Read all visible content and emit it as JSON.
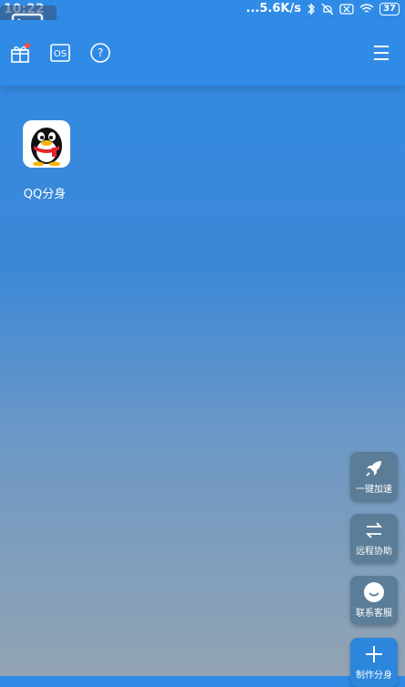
{
  "status_bar": {
    "time": "10:22",
    "network_speed": "...5.6K/s",
    "battery_level": "37"
  },
  "header": {
    "icons": [
      "gift-icon",
      "os-icon",
      "help-icon",
      "menu-icon"
    ],
    "os_label": "OS",
    "help_label": "?"
  },
  "apps": [
    {
      "label": "QQ分身",
      "icon": "qq-penguin-icon"
    }
  ],
  "floating_buttons": [
    {
      "label": "一键加速",
      "icon": "rocket-icon"
    },
    {
      "label": "远程协助",
      "icon": "transfer-arrows-icon"
    },
    {
      "label": "联系客服",
      "icon": "smiley-icon"
    },
    {
      "label": "制作分身",
      "icon": "plus-icon"
    }
  ],
  "colors": {
    "primary": "#2f8be6",
    "fab_gray": "#5b7d97",
    "fab_blue": "#2b86dc"
  }
}
